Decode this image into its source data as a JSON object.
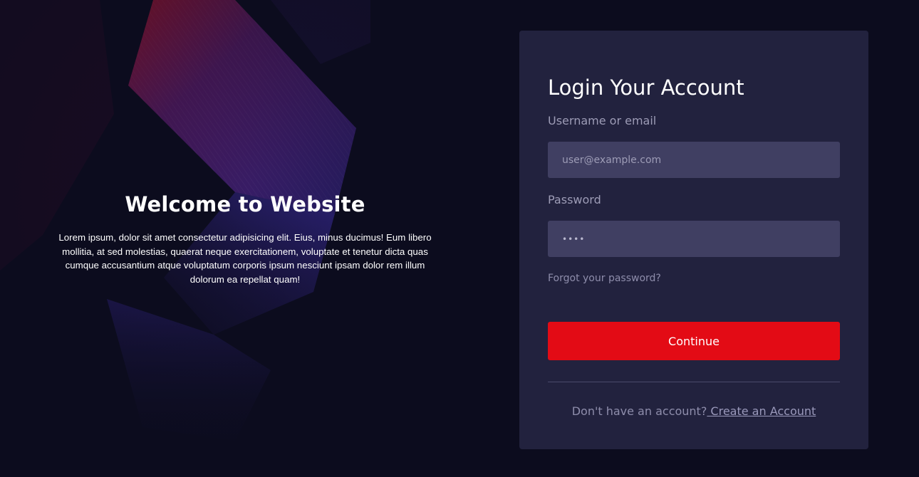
{
  "hero": {
    "title": "Welcome to Website",
    "text": "Lorem ipsum, dolor sit amet consectetur adipisicing elit. Eius, minus ducimus! Eum libero mollitia, at sed molestias, quaerat neque exercitationem, voluptate et tenetur dicta quas cumque accusantium atque voluptatum corporis ipsum nesciunt ipsam dolor rem illum dolorum ea repellat quam!"
  },
  "login": {
    "title": "Login Your Account",
    "username_label": "Username or email",
    "username_placeholder": "user@example.com",
    "password_label": "Password",
    "password_value": "••••",
    "forgot_link": "Forgot your password?",
    "continue_label": "Continue",
    "no_account_text": "Don't have an account?",
    "create_account_link": " Create an Account"
  },
  "colors": {
    "background": "#0c0c1e",
    "card": "#22223e",
    "input": "#403f62",
    "accent": "#e30b15",
    "muted_text": "#9d9cb6"
  }
}
